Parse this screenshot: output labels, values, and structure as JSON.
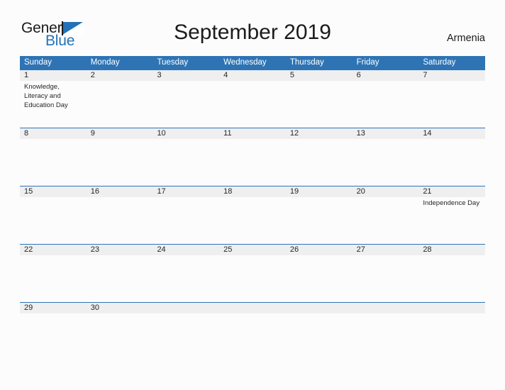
{
  "brand": {
    "name_part1": "General",
    "name_part2": "Blue",
    "flag_icon": "blue-triangle-flag-icon",
    "color_dark": "#1b1b1b",
    "color_blue": "#2272b8"
  },
  "header": {
    "title": "September 2019",
    "region": "Armenia"
  },
  "theme": {
    "header_blue": "#2e74b5",
    "date_band_gray": "#efefef",
    "page_background": "#fcfcfd",
    "text_color": "#262626"
  },
  "calendar": {
    "weekdays": [
      "Sunday",
      "Monday",
      "Tuesday",
      "Wednesday",
      "Thursday",
      "Friday",
      "Saturday"
    ],
    "weeks": [
      {
        "dates": [
          "1",
          "2",
          "3",
          "4",
          "5",
          "6",
          "7"
        ],
        "events": [
          "Knowledge, Literacy and Education Day",
          "",
          "",
          "",
          "",
          "",
          ""
        ]
      },
      {
        "dates": [
          "8",
          "9",
          "10",
          "11",
          "12",
          "13",
          "14"
        ],
        "events": [
          "",
          "",
          "",
          "",
          "",
          "",
          ""
        ]
      },
      {
        "dates": [
          "15",
          "16",
          "17",
          "18",
          "19",
          "20",
          "21"
        ],
        "events": [
          "",
          "",
          "",
          "",
          "",
          "",
          "Independence Day"
        ]
      },
      {
        "dates": [
          "22",
          "23",
          "24",
          "25",
          "26",
          "27",
          "28"
        ],
        "events": [
          "",
          "",
          "",
          "",
          "",
          "",
          ""
        ]
      },
      {
        "dates": [
          "29",
          "30",
          "",
          "",
          "",
          "",
          ""
        ],
        "events": [
          "",
          "",
          "",
          "",
          "",
          "",
          ""
        ]
      }
    ]
  }
}
